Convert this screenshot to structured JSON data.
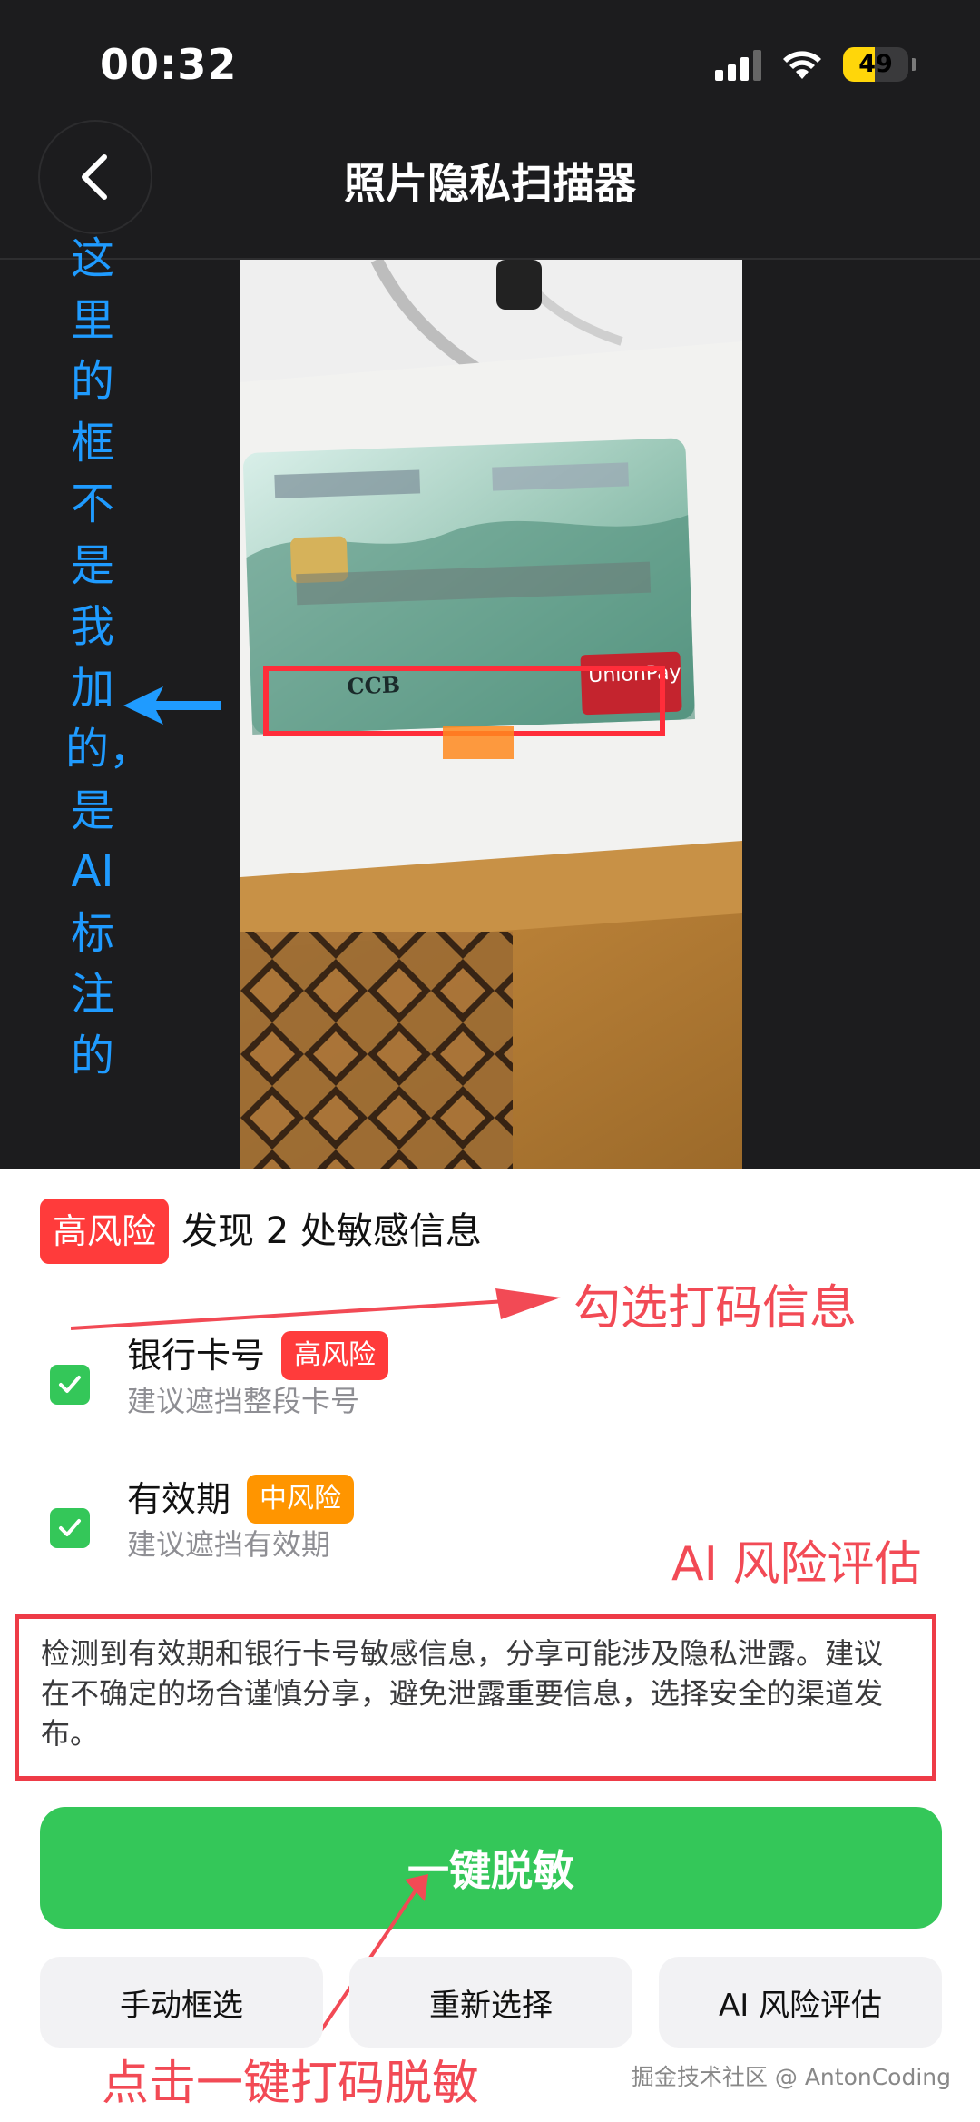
{
  "status_bar": {
    "time": "00:32",
    "battery": "49"
  },
  "nav": {
    "title": "照片隐私扫描器"
  },
  "annotations": {
    "left_vertical": "这里的框不是我加的，是AI标注的",
    "select_info": "勾选打码信息",
    "ai_assess": "AI 风险评估",
    "click_hint": "点击一键打码脱敏"
  },
  "summary": {
    "badge": "高风险",
    "text": "发现 2 处敏感信息"
  },
  "items": [
    {
      "title": "银行卡号",
      "tag": "高风险",
      "subtitle": "建议遮挡整段卡号",
      "checked": true,
      "tag_color": "#ff3b3b"
    },
    {
      "title": "有效期",
      "tag": "中风险",
      "subtitle": "建议遮挡有效期",
      "checked": true,
      "tag_color": "#ff9500"
    }
  ],
  "assessment": "检测到有效期和银行卡号敏感信息，分享可能涉及隐私泄露。建议在不确定的场合谨慎分享，避免泄露重要信息，选择安全的渠道发布。",
  "buttons": {
    "primary": "一键脱敏",
    "manual": "手动框选",
    "reselect": "重新选择",
    "ai_assess": "AI 风险评估"
  },
  "watermark": "掘金技术社区 @ AntonCoding",
  "colors": {
    "accent_green": "#34c759",
    "high_risk": "#ff3b3b",
    "mid_risk": "#ff9500",
    "annotation_blue": "#1f9bff",
    "annotation_red": "#f24a55"
  }
}
